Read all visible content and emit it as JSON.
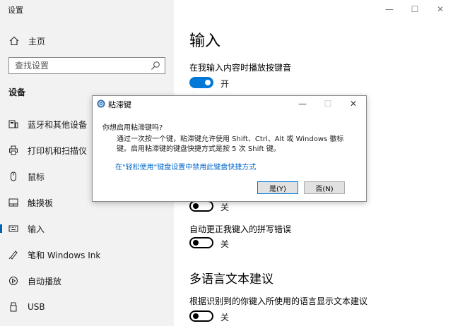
{
  "app_title": "设置",
  "sidebar": {
    "home_label": "主页",
    "search_placeholder": "查找设置",
    "section_title": "设备",
    "items": [
      {
        "label": "蓝牙和其他设备",
        "icon": "bluetooth-devices-icon"
      },
      {
        "label": "打印机和扫描仪",
        "icon": "printer-icon"
      },
      {
        "label": "鼠标",
        "icon": "mouse-icon"
      },
      {
        "label": "触摸板",
        "icon": "touchpad-icon"
      },
      {
        "label": "输入",
        "icon": "keyboard-icon",
        "active": true
      },
      {
        "label": "笔和 Windows Ink",
        "icon": "pen-icon"
      },
      {
        "label": "自动播放",
        "icon": "autoplay-icon"
      },
      {
        "label": "USB",
        "icon": "usb-icon"
      }
    ]
  },
  "window_controls": {
    "minimize": "—",
    "maximize": "☐",
    "close": "✕"
  },
  "main": {
    "page_title": "输入",
    "settings": [
      {
        "label": "在我输入内容时播放按键音",
        "state": "开",
        "on": true
      },
      {
        "label": "",
        "state": "关",
        "on": false
      },
      {
        "label": "自动更正我键入的拼写错误",
        "state": "关",
        "on": false
      }
    ],
    "multilang_heading": "多语言文本建议",
    "multilang_setting": {
      "label": "根据识别到的你键入所使用的语言显示文本建议",
      "state": "关",
      "on": false
    }
  },
  "dialog": {
    "title": "粘滞键",
    "question": "你想启用粘滞键吗?",
    "body": "通过一次按一个键，粘滞键允许使用 Shift、Ctrl、Alt 或 Windows 徽标键。启用粘滞键的键盘快捷方式是按 5 次 Shift 键。",
    "link": "在\"轻松使用\"键盘设置中禁用此键盘快捷方式",
    "yes_button": "是(Y)",
    "no_button": "否(N)",
    "controls": {
      "minimize": "—",
      "maximize": "☐",
      "close": "✕"
    }
  },
  "colors": {
    "accent": "#0078d7",
    "sidebar_bg": "#f2f2f2",
    "link": "#0066cc"
  }
}
